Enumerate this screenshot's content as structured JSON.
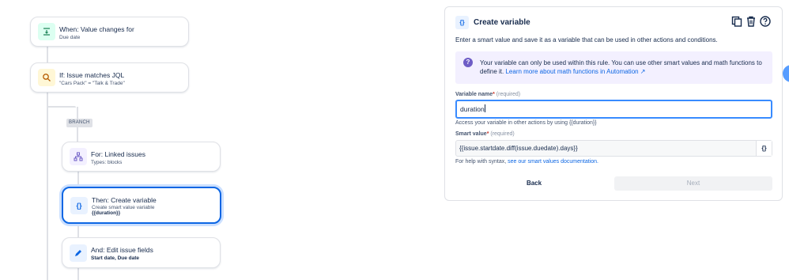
{
  "flow": {
    "trigger": {
      "title": "When: Value changes for",
      "subtitle": "Due date",
      "icon": "value-change-icon"
    },
    "condition": {
      "title": "If: Issue matches JQL",
      "subtitle": "\"Cars Pack\" = \"Talk & Trade\"",
      "icon": "search-icon"
    },
    "branch_label": "BRANCH",
    "branch_card": {
      "title": "For: Linked issues",
      "subtitle": "Types: blocks",
      "icon": "hierarchy-icon"
    },
    "create_var": {
      "title": "Then: Create variable",
      "subtitle": "Create smart value variable",
      "subtitle2": "{{duration}}",
      "icon": "braces-icon"
    },
    "edit_fields": {
      "title": "And: Edit issue fields",
      "subtitle": "Start date, Due date",
      "icon": "pencil-icon"
    }
  },
  "panel": {
    "title": "Create variable",
    "icons": [
      "duplicate-icon",
      "trash-icon",
      "help-icon"
    ],
    "description": "Enter a smart value and save it as a variable that can be used in other actions and conditions.",
    "note": {
      "text": "Your variable can only be used within this rule. You can use other smart values and math functions to define it.",
      "link": "Learn more about math functions in Automation ↗"
    },
    "variable_name": {
      "label": "Variable name",
      "required_mark": "*",
      "required": "(required)",
      "value": "duration",
      "help": "Access your variable in other actions by using {{duration}}"
    },
    "smart_value": {
      "label": "Smart value",
      "required_mark": "*",
      "required": "(required)",
      "value": "{{issue.startdate.diff(issue.duedate).days}}",
      "button": "{}",
      "help_prefix": "For help with syntax,",
      "help_link": "see our smart values documentation."
    },
    "buttons": {
      "back": "Back",
      "next": "Next"
    }
  },
  "colors": {
    "accent": "#0c66e4",
    "note_bg": "#f3f0ff",
    "selected_border": "#0c66e4"
  }
}
